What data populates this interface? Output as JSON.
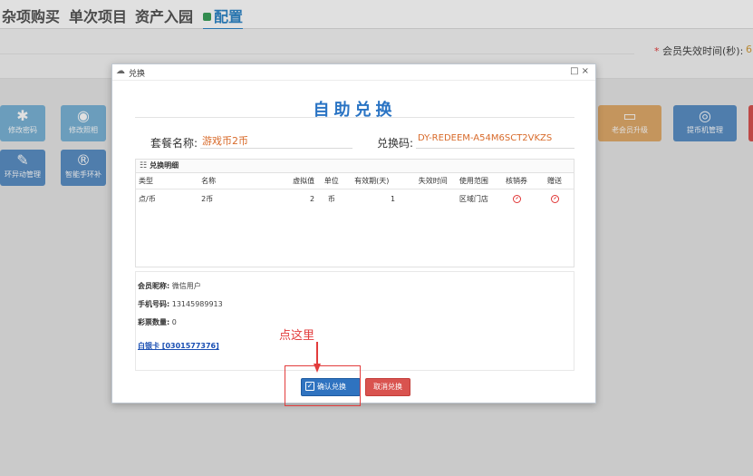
{
  "nav": {
    "items": [
      "杂项购买",
      "单次项目",
      "资产入园"
    ],
    "active": "配置"
  },
  "subbar": {
    "required_label": "会员失效时间(秒):",
    "required_value": "6"
  },
  "tiles": [
    {
      "label": "修改密码",
      "icon": "asterisk-icon",
      "color": "#7ab3d6"
    },
    {
      "label": "修改照相",
      "icon": "camera-icon",
      "color": "#7ab3d6"
    },
    {
      "label": "环异动管理",
      "icon": "edit-icon",
      "color": "#5b8fc4"
    },
    {
      "label": "智能手环补",
      "icon": "registered-icon",
      "color": "#5b8fc4"
    },
    {
      "label": "老会员升级",
      "icon": "card-icon",
      "color": "#e0aa6a"
    },
    {
      "label": "提币机管理",
      "icon": "gamepad-icon",
      "color": "#5b8fc4"
    }
  ],
  "modal": {
    "window_title": "兑换",
    "title": "自助兑换",
    "package_label": "套餐名称:",
    "package_value": "游戏币2币",
    "code_label": "兑换码:",
    "code_value": "DY-REDEEM-A54M6SCT2VKZS",
    "detail_title": "兑换明细",
    "columns": [
      "类型",
      "名称",
      "虚拟值",
      "单位",
      "有效期(天)",
      "失效时间",
      "使用范围",
      "核销券",
      "赠送"
    ],
    "rows": [
      {
        "type": "点/币",
        "name": "2币",
        "value": "2",
        "unit": "币",
        "valid_days": "1",
        "expire": "",
        "scope": "区域门店"
      }
    ],
    "member": {
      "nickname_label": "会员昵称:",
      "nickname": "微信用户",
      "phone_label": "手机号码:",
      "phone": "13145989913",
      "tickets_label": "彩票数量:",
      "tickets": "0",
      "card_link": "白银卡 [0301577376]"
    },
    "confirm_label": "确认兑换",
    "cancel_label": "取消兑换"
  },
  "annotation": {
    "text": "点这里",
    "color": "#e23c3c"
  }
}
